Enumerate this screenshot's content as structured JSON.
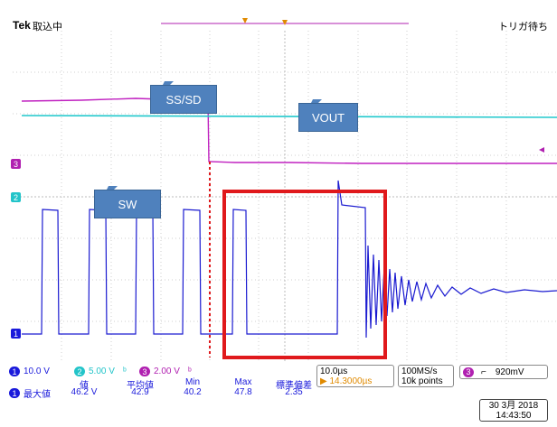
{
  "header": {
    "brand": "Tek",
    "mode": "取込中",
    "trigger_status": "トリガ待ち"
  },
  "callouts": {
    "sssd": "SS/SD",
    "vout": "VOUT",
    "sw": "SW"
  },
  "channels": {
    "ch1": {
      "label": "1",
      "color": "#1a1adb",
      "scale": "10.0 V"
    },
    "ch2": {
      "label": "2",
      "color": "#22c4c9",
      "scale": "5.00 V"
    },
    "ch3": {
      "label": "3",
      "color": "#b020b0",
      "scale": "2.00 V"
    }
  },
  "bandwidth_symbols": {
    "ch2": "ᵇ",
    "ch3": "ᵇ"
  },
  "horizontal": {
    "timebase": "10.0µs",
    "trigger_position": "▶ 14.3000µs",
    "sample_rate": "100MS/s",
    "record_length": "10k points"
  },
  "trigger": {
    "channel": "3",
    "slope_icon": "falling-edge",
    "slope_symbol": "⌐",
    "level": "920mV"
  },
  "measurements": {
    "row_label": "最大値",
    "headers": [
      "値",
      "平均値",
      "Min",
      "Max",
      "標準偏差"
    ],
    "values": [
      "46.2 V",
      "42.9",
      "40.2",
      "47.8",
      "2.35"
    ]
  },
  "datetime": {
    "date": "30 3月  2018",
    "time": "14:43:50"
  },
  "colors": {
    "highlight_box": "#e0191c",
    "grid": "#d0d0d0",
    "callout_bg": "#4f81bd"
  }
}
